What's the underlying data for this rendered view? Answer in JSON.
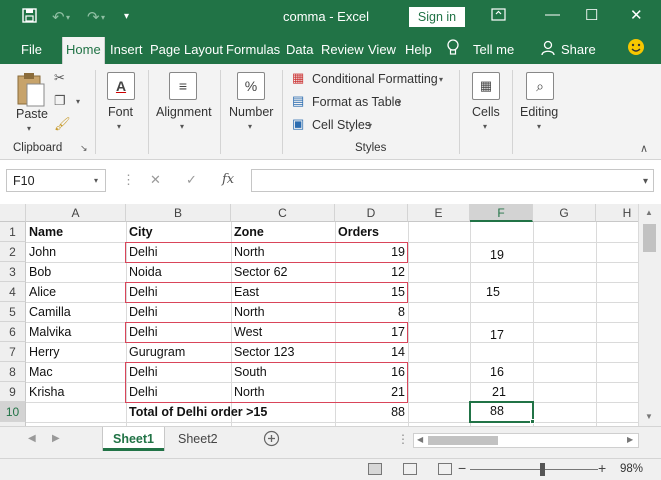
{
  "titlebar": {
    "title": "comma  -  Excel",
    "signin": "Sign in",
    "colors": {
      "excel_green": "#217346"
    },
    "icons": [
      "save-icon",
      "undo-icon",
      "redo-icon",
      "customize-caret-icon",
      "ribbon-display-icon",
      "minimize-icon",
      "maximize-icon",
      "close-icon"
    ],
    "winbtns": {
      "minimize": "—",
      "maximize": "☐",
      "close": "✕"
    }
  },
  "tabs": [
    {
      "label": "File"
    },
    {
      "label": "Home"
    },
    {
      "label": "Insert"
    },
    {
      "label": "Page Layout"
    },
    {
      "label": "Formulas"
    },
    {
      "label": "Data"
    },
    {
      "label": "Review"
    },
    {
      "label": "View"
    },
    {
      "label": "Help"
    }
  ],
  "active_tab": "Home",
  "tellme": "Tell me",
  "share": "Share",
  "ribbon": {
    "clipboard": {
      "paste": "Paste",
      "group": "Clipboard"
    },
    "font": {
      "label": "Font"
    },
    "alignment": {
      "label": "Alignment"
    },
    "number": {
      "label": "Number",
      "icon_text": "%"
    },
    "styles": {
      "conditional": "Conditional Formatting",
      "table": "Format as Table",
      "cellstyles": "Cell Styles",
      "group": "Styles"
    },
    "cells": {
      "label": "Cells"
    },
    "editing": {
      "label": "Editing"
    }
  },
  "formulabar": {
    "namebox": "F10",
    "cancel": "✕",
    "enter": "✓",
    "fx": "fx"
  },
  "grid": {
    "columns": [
      "A",
      "B",
      "C",
      "D",
      "E",
      "F",
      "G",
      "H"
    ],
    "selected_column": "F",
    "rows": [
      "1",
      "2",
      "3",
      "4",
      "5",
      "6",
      "7",
      "8",
      "9",
      "10"
    ],
    "selected_row": "10",
    "headers": {
      "name": "Name",
      "city": "City",
      "zone": "Zone",
      "orders": "Orders"
    },
    "data": [
      {
        "name": "John",
        "city": "Delhi",
        "zone": "North",
        "orders": "19",
        "f": "19"
      },
      {
        "name": "Bob",
        "city": "Noida",
        "zone": "Sector 62",
        "orders": "12",
        "f": ""
      },
      {
        "name": "Alice",
        "city": "Delhi",
        "zone": "East",
        "orders": "15",
        "f": "15"
      },
      {
        "name": "Camilla",
        "city": "Delhi",
        "zone": "North",
        "orders": "8",
        "f": ""
      },
      {
        "name": "Malvika",
        "city": "Delhi",
        "zone": "West",
        "orders": "17",
        "f": "17"
      },
      {
        "name": "Herry",
        "city": "Gurugram",
        "zone": "Sector 123",
        "orders": "14",
        "f": ""
      },
      {
        "name": "Mac",
        "city": "Delhi",
        "zone": "South",
        "orders": "16",
        "f": "16"
      },
      {
        "name": "Krisha",
        "city": "Delhi",
        "zone": "North",
        "orders": "21",
        "f": "21"
      }
    ],
    "total_label": "Total of Delhi order >15",
    "total_value": "88",
    "f10_value": "88",
    "highlight_color": "#d9455a"
  },
  "sheets": [
    {
      "label": "Sheet1"
    },
    {
      "label": "Sheet2"
    }
  ],
  "active_sheet": "Sheet1",
  "status": {
    "zoom_minus": "−",
    "zoom_plus": "+",
    "zoom": "98%"
  }
}
